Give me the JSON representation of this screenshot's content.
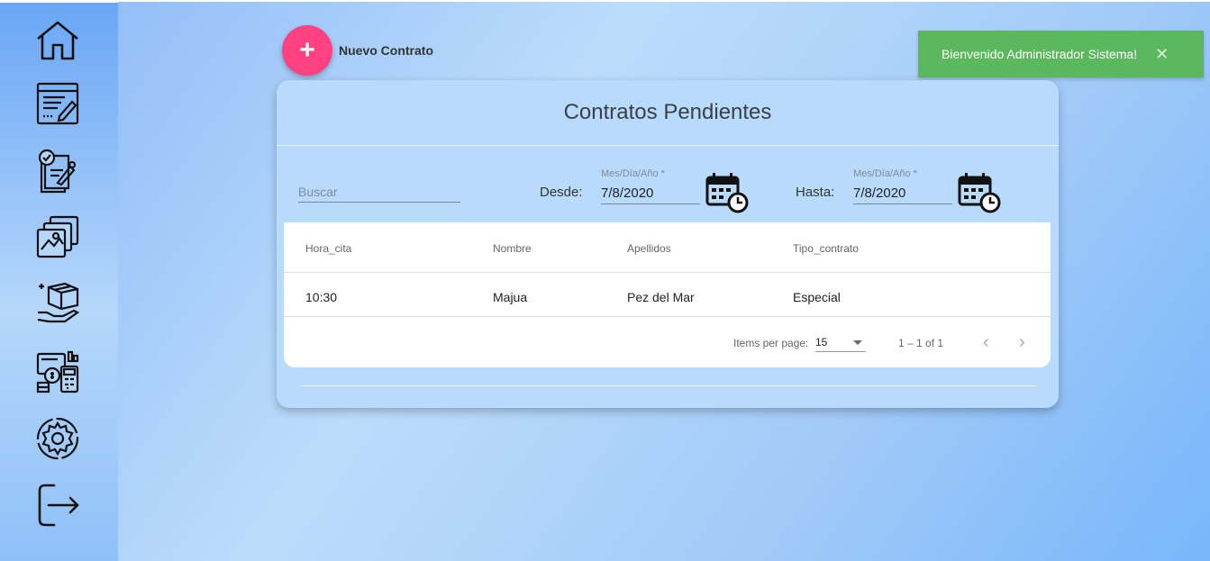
{
  "sidebar": {
    "items": [
      {
        "icon": "home-icon"
      },
      {
        "icon": "contract-edit-icon"
      },
      {
        "icon": "document-approve-icon"
      },
      {
        "icon": "gallery-icon"
      },
      {
        "icon": "delivery-box-icon"
      },
      {
        "icon": "finance-calculator-icon"
      },
      {
        "icon": "settings-gear-icon"
      },
      {
        "icon": "logout-icon"
      }
    ]
  },
  "header": {
    "fab_symbol": "+",
    "new_contract_label": "Nuevo Contrato"
  },
  "toast": {
    "message": "Bienvenido Administrador Sistema!",
    "close_symbol": "✕",
    "color": "#5cb85c"
  },
  "card": {
    "title": "Contratos Pendientes",
    "search_placeholder": "Buscar",
    "from": {
      "label": "Desde:",
      "placeholder": "Mes/Día/Año *",
      "value": "7/8/2020"
    },
    "to": {
      "label": "Hasta:",
      "placeholder": "Mes/Día/Año *",
      "value": "7/8/2020"
    }
  },
  "table": {
    "columns": [
      "Hora_cita",
      "Nombre",
      "Apellidos",
      "Tipo_contrato"
    ],
    "rows": [
      [
        "10:30",
        "Majua",
        "Pez del Mar",
        "Especial"
      ]
    ]
  },
  "paginator": {
    "items_label": "Items per page:",
    "page_size": "15",
    "range": "1 – 1 of 1",
    "prev_symbol": "‹",
    "next_symbol": "›"
  },
  "colors": {
    "accent": "#ff4081",
    "card_bg": "#b8dafc"
  }
}
